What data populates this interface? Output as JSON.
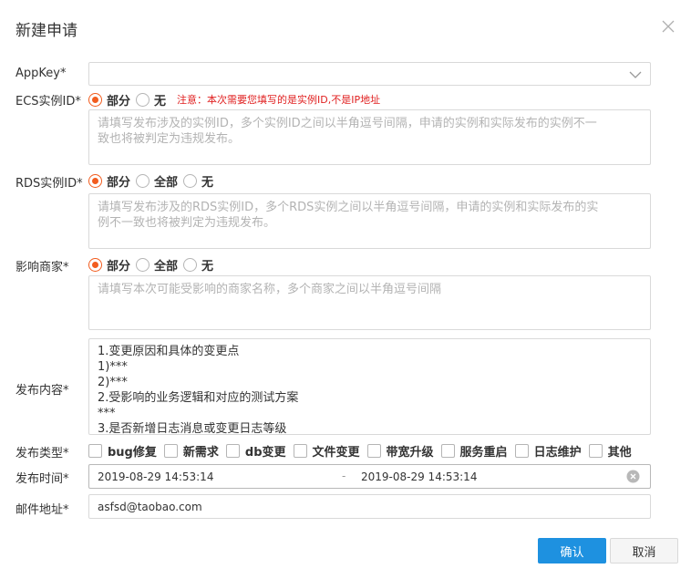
{
  "dialog": {
    "title": "新建申请"
  },
  "appkey": {
    "label": "AppKey*",
    "value": ""
  },
  "ecs": {
    "label": "ECS实例ID*",
    "options": [
      "部分",
      "无"
    ],
    "selected": "部分",
    "warning": "注意：本次需要您填写的是实例ID,不是IP地址",
    "placeholder_lines": [
      "请填写发布涉及的实例ID，多个实例ID之间以半角逗号间隔，申请的实例和实际发布的实例不一",
      "致也将被判定为违规发布。"
    ]
  },
  "rds": {
    "label": "RDS实例ID*",
    "options": [
      "部分",
      "全部",
      "无"
    ],
    "selected": "部分",
    "placeholder_lines": [
      "请填写发布涉及的RDS实例ID，多个RDS实例之间以半角逗号间隔，申请的实例和实际发布的实",
      "例不一致也将被判定为违规发布。"
    ]
  },
  "merchant": {
    "label": "影响商家*",
    "options": [
      "部分",
      "全部",
      "无"
    ],
    "selected": "部分",
    "placeholder_lines": [
      "请填写本次可能受影响的商家名称，多个商家之间以半角逗号间隔"
    ]
  },
  "content": {
    "label": "发布内容*",
    "lines": [
      "1.变更原因和具体的变更点",
      "1)***",
      "2)***",
      "2.受影响的业务逻辑和对应的测试方案",
      "***",
      "3.是否新增日志消息或变更日志等级",
      "***"
    ]
  },
  "release_type": {
    "label": "发布类型*",
    "options": [
      "bug修复",
      "新需求",
      "db变更",
      "文件变更",
      "带宽升级",
      "服务重启",
      "日志维护",
      "其他"
    ]
  },
  "release_time": {
    "label": "发布时间*",
    "start": "2019-08-29 14:53:14",
    "separator": "-",
    "end": "2019-08-29 14:53:14"
  },
  "email": {
    "label": "邮件地址*",
    "value": "asfsd@taobao.com"
  },
  "buttons": {
    "confirm": "确认",
    "cancel": "取消"
  },
  "colors": {
    "accent": "#f25c1e",
    "primary": "#1e91e0",
    "warning": "#e02020"
  }
}
